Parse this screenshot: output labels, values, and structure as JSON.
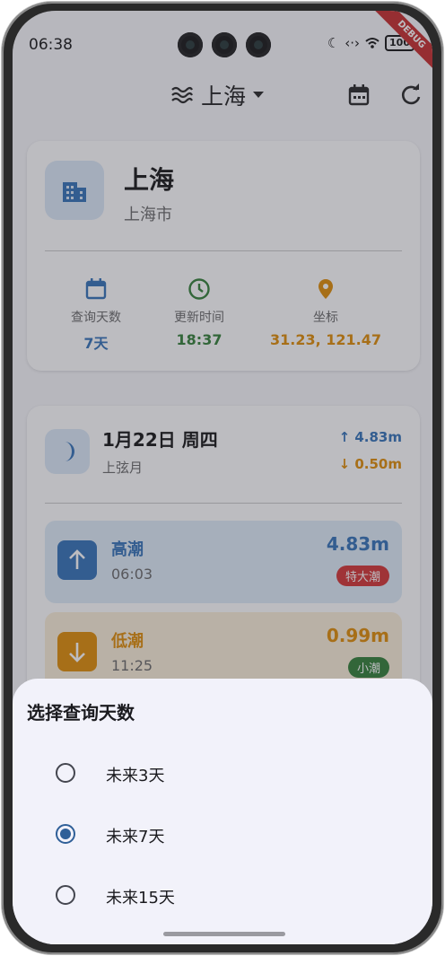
{
  "status": {
    "time": "06:38",
    "battery": "100"
  },
  "debug_banner": "DEBUG",
  "appbar": {
    "title": "上海"
  },
  "city": {
    "name": "上海",
    "sub": "上海市",
    "stats": [
      {
        "label": "查询天数",
        "value": "7天",
        "color": "#2f6fb6"
      },
      {
        "label": "更新时间",
        "value": "18:37",
        "color": "#2e7d32"
      },
      {
        "label": "坐标",
        "value": "31.23, 121.47",
        "color": "#e08a00"
      }
    ]
  },
  "tide": {
    "date": "1月22日 周四",
    "phase": "上弦月",
    "high_summary": "↑ 4.83m",
    "low_summary": "↓ 0.50m",
    "entries": [
      {
        "name": "高潮",
        "time": "06:03",
        "height": "4.83m",
        "badge": "特大潮"
      },
      {
        "name": "低潮",
        "time": "11:25",
        "height": "0.99m",
        "badge": "小潮"
      }
    ]
  },
  "sheet": {
    "title": "选择查询天数",
    "options": [
      {
        "label": "未来3天",
        "selected": false
      },
      {
        "label": "未来7天",
        "selected": true
      },
      {
        "label": "未来15天",
        "selected": false
      }
    ]
  },
  "colors": {
    "primary": "#2f6fb6",
    "green": "#2e7d32",
    "orange": "#e08a00",
    "red": "#d32f2f",
    "radio": "#2f5f98"
  }
}
